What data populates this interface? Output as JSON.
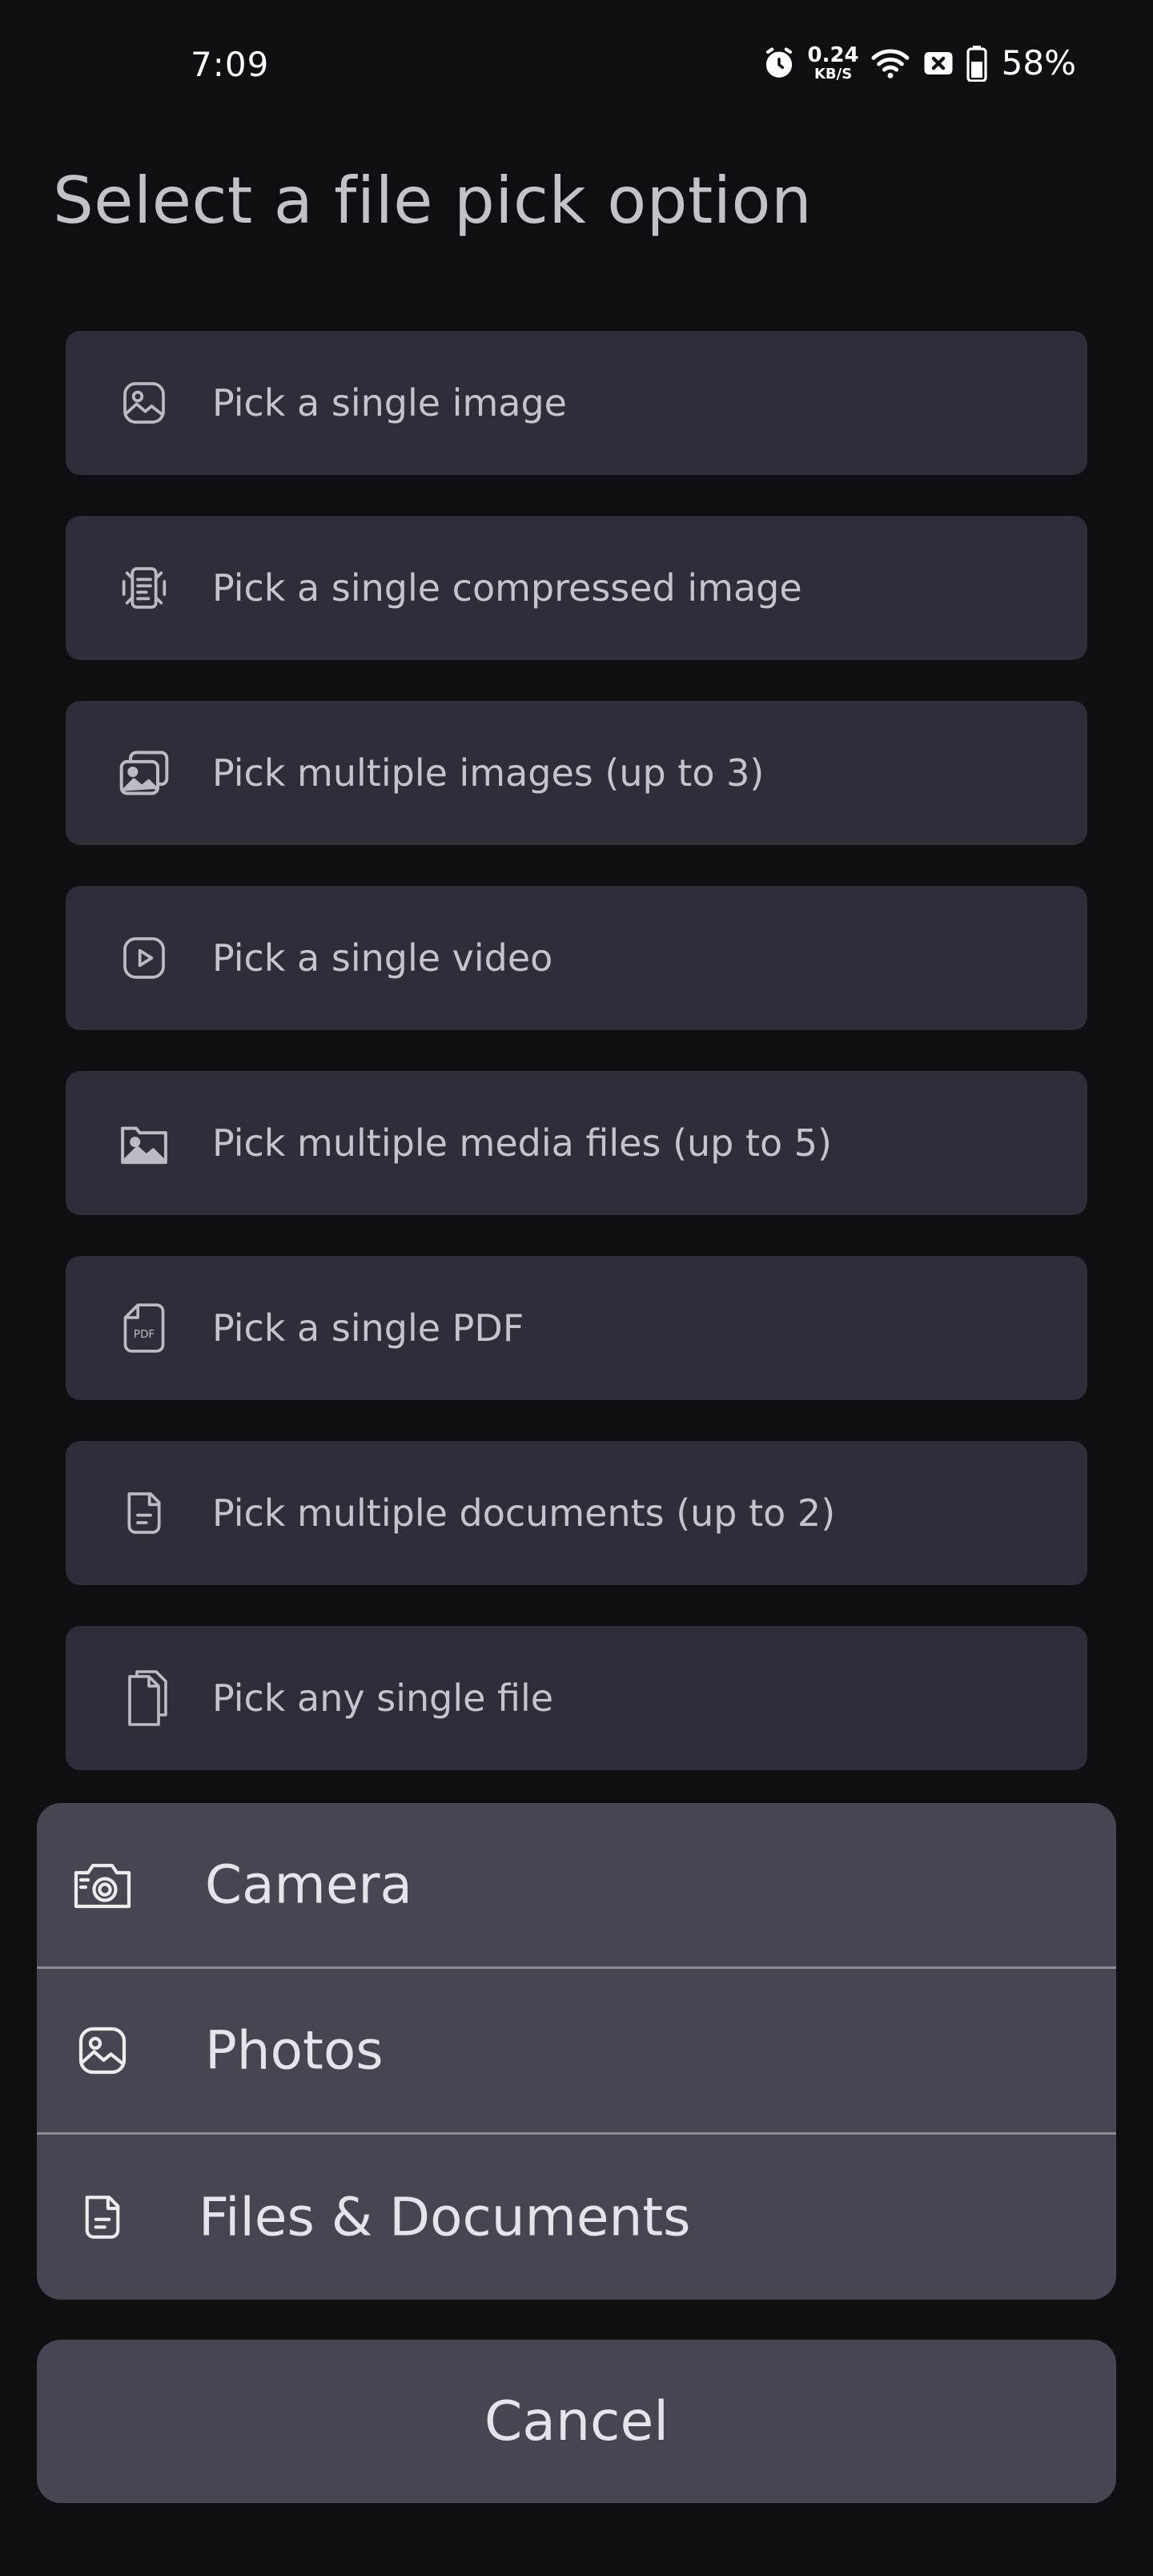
{
  "status_bar": {
    "time": "7:09",
    "net_speed_value": "0.24",
    "net_speed_unit": "KB/S",
    "battery_percent": "58%",
    "icons": [
      "alarm-icon",
      "wifi-icon",
      "sim-off-icon",
      "battery-icon"
    ]
  },
  "page": {
    "title": "Select a file pick option"
  },
  "options": [
    {
      "label": "Pick a single image",
      "icon": "image-icon"
    },
    {
      "label": "Pick a single compressed image",
      "icon": "compress-icon"
    },
    {
      "label": "Pick multiple images (up to 3)",
      "icon": "images-icon"
    },
    {
      "label": "Pick a single video",
      "icon": "video-icon"
    },
    {
      "label": "Pick multiple media files (up to 5)",
      "icon": "media-icon"
    },
    {
      "label": "Pick a single PDF",
      "icon": "pdf-icon"
    },
    {
      "label": "Pick multiple documents (up to 2)",
      "icon": "document-icon"
    },
    {
      "label": "Pick any single file",
      "icon": "file-icon"
    }
  ],
  "action_sheet": {
    "items": [
      {
        "label": "Camera",
        "icon": "camera-icon"
      },
      {
        "label": "Photos",
        "icon": "photos-icon"
      },
      {
        "label": "Files & Documents",
        "icon": "files-icon"
      }
    ],
    "cancel_label": "Cancel"
  },
  "colors": {
    "background": "#0f0e13",
    "option_bg": "#302d39",
    "sheet_bg": "#47454f",
    "text_muted": "#c6c3cc",
    "text_light": "#e6e4ea"
  }
}
